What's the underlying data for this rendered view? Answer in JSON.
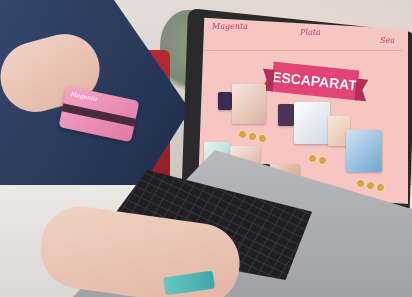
{
  "site": {
    "nav": [
      "Magenta",
      "Plata",
      "Sea"
    ],
    "banner_title": "ESCAPARATE"
  },
  "credit_card": {
    "brand_text": "Magenta"
  },
  "colors": {
    "screen_bg": "#f6c6c3",
    "banner": "#e24575",
    "nav_text": "#c23c60",
    "card_pink": "#e07aa6"
  },
  "icons": [
    "pearl-dot-icon"
  ]
}
